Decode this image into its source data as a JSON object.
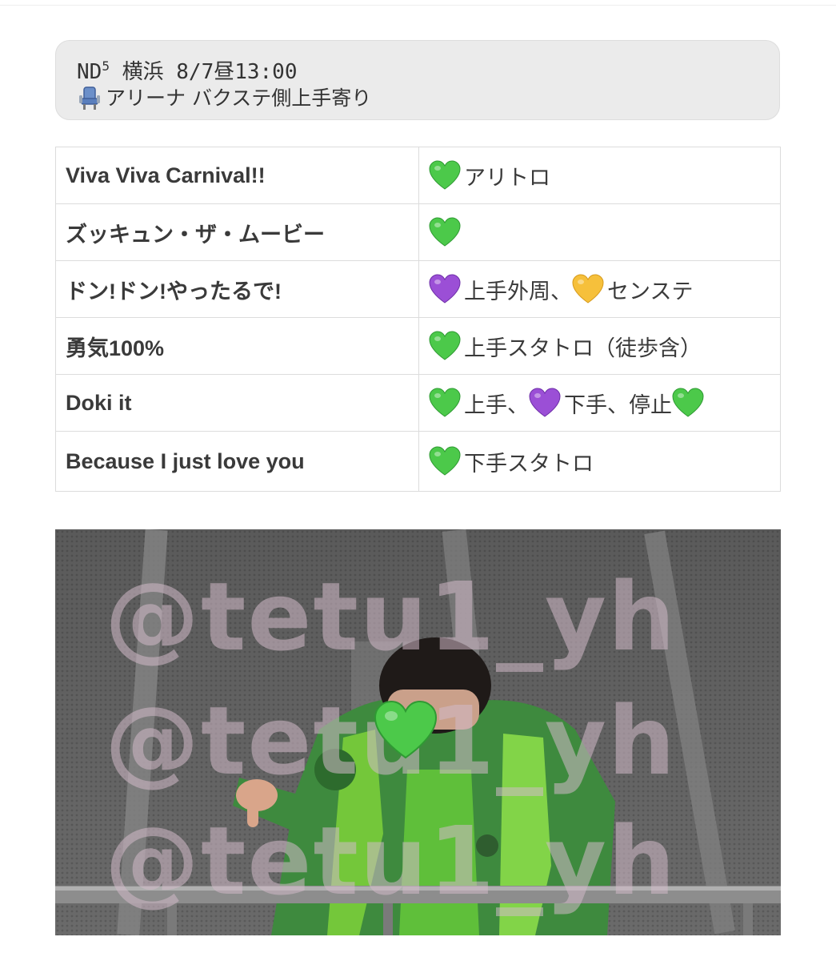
{
  "note": {
    "line1_prefix": "ND",
    "line1_sup": "5",
    "line1_rest": " 横浜 8/7昼13:00",
    "seat_icon": "seat-icon",
    "line2": "アリーナ バクステ側上手寄り"
  },
  "colors": {
    "green_heart": "#4CC94A",
    "purple_heart": "#9B4FD6",
    "yellow_heart": "#F6C03B"
  },
  "setlist": [
    {
      "song": "Viva Viva Carnival!!",
      "note": [
        {
          "heart": "green"
        },
        {
          "text": "アリトロ"
        }
      ]
    },
    {
      "song": "ズッキュン・ザ・ムービー",
      "note": [
        {
          "heart": "green"
        }
      ]
    },
    {
      "song": "ドン!ドン!やったるで!",
      "note": [
        {
          "heart": "purple"
        },
        {
          "text": "上手外周、"
        },
        {
          "heart": "yellow"
        },
        {
          "text": "センステ"
        }
      ]
    },
    {
      "song": "勇気100%",
      "note": [
        {
          "heart": "green"
        },
        {
          "text": "上手スタトロ（徒歩含）"
        }
      ]
    },
    {
      "song": "Doki it",
      "note": [
        {
          "heart": "green"
        },
        {
          "text": "上手、"
        },
        {
          "heart": "purple"
        },
        {
          "text": "下手、停止"
        },
        {
          "heart": "green"
        }
      ]
    },
    {
      "song": "Because I just love you",
      "note": [
        {
          "heart": "green"
        },
        {
          "text": "下手スタトロ"
        }
      ]
    }
  ],
  "photo": {
    "watermark": "@tetu1_yh",
    "face_cover_icon": "green-heart-icon"
  }
}
